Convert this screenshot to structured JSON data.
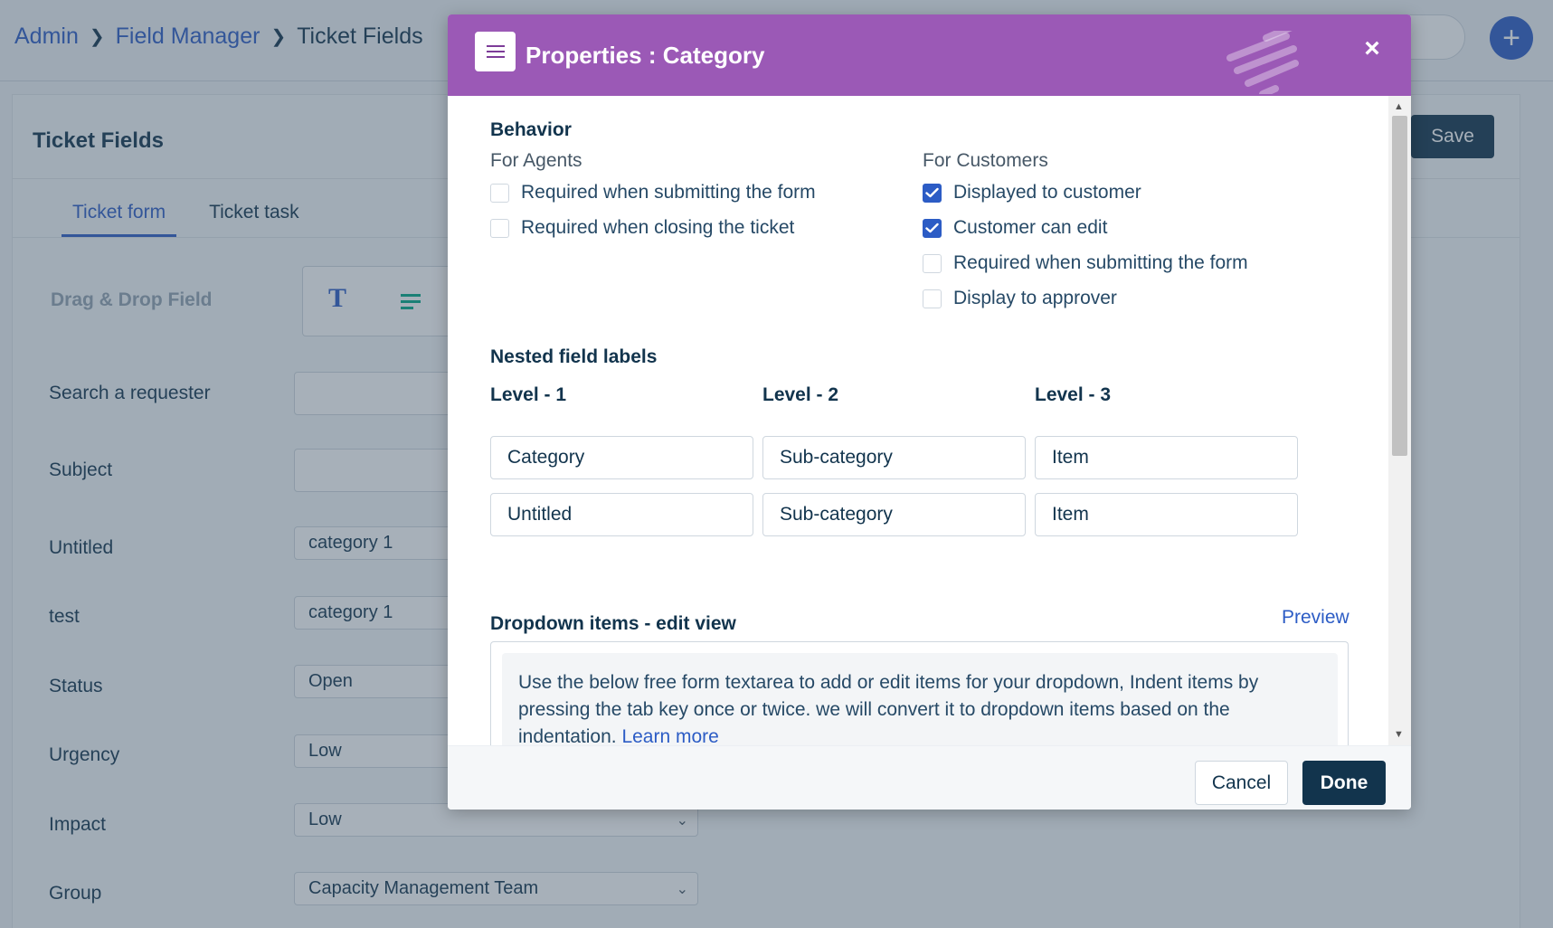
{
  "breadcrumb": {
    "admin": "Admin",
    "field_manager": "Field Manager",
    "current": "Ticket Fields"
  },
  "page": {
    "title": "Ticket Fields",
    "save_label": "Save",
    "tabs": [
      {
        "label": "Ticket form"
      },
      {
        "label": "Ticket task"
      }
    ],
    "drag_drop_label": "Drag & Drop Field",
    "drag_drop_text_glyph": "T",
    "form_rows": [
      {
        "label": "Search a requester",
        "value": ""
      },
      {
        "label": "Subject",
        "value": ""
      },
      {
        "label": "Untitled",
        "value": "category 1"
      },
      {
        "label": "test",
        "value": "category 1"
      },
      {
        "label": "Status",
        "value": "Open"
      },
      {
        "label": "Urgency",
        "value": "Low"
      },
      {
        "label": "Impact",
        "value": "Low"
      },
      {
        "label": "Group",
        "value": "Capacity Management Team"
      }
    ]
  },
  "modal": {
    "title": "Properties : Category",
    "close_glyph": "×",
    "behavior": {
      "title": "Behavior",
      "agents_label": "For Agents",
      "customers_label": "For Customers",
      "agents": [
        {
          "label": "Required when submitting the form",
          "checked": false
        },
        {
          "label": "Required when closing the ticket",
          "checked": false
        }
      ],
      "customers": [
        {
          "label": "Displayed to customer",
          "checked": true
        },
        {
          "label": "Customer can edit",
          "checked": true
        },
        {
          "label": "Required when submitting the form",
          "checked": false
        },
        {
          "label": "Display to approver",
          "checked": false
        }
      ]
    },
    "nested": {
      "title": "Nested field labels",
      "levels": [
        "Level - 1",
        "Level - 2",
        "Level - 3"
      ],
      "rows": [
        [
          "Category",
          "Sub-category",
          "Item"
        ],
        [
          "Untitled",
          "Sub-category",
          "Item"
        ]
      ]
    },
    "dropdown": {
      "title": "Dropdown items - edit view",
      "preview_label": "Preview",
      "info_text": "Use the below free form textarea to add or edit items for your dropdown, Indent items by pressing the tab key once or twice. we will convert it to dropdown items based on the indentation.",
      "learn_more": "Learn more"
    },
    "cancel_label": "Cancel",
    "done_label": "Done"
  },
  "colors": {
    "header": "#9b59b6",
    "primary": "#12344d",
    "link": "#2c5cc5",
    "checked": "#2c5cc5"
  }
}
